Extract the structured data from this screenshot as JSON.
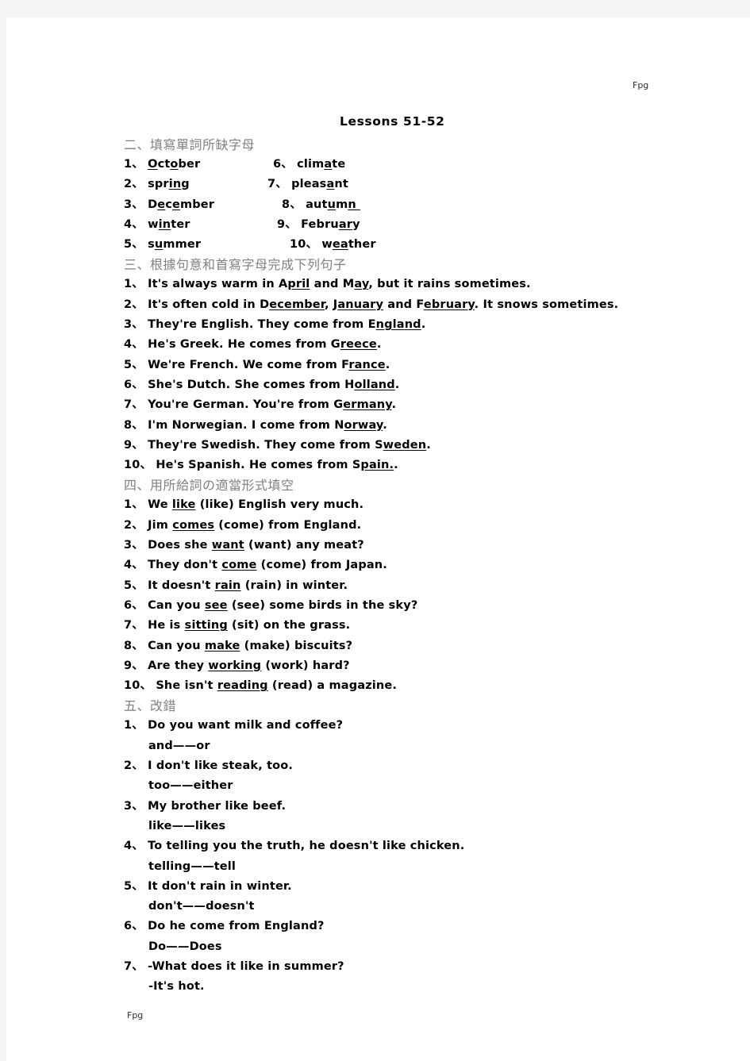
{
  "document": {
    "title": "Lessons 51-52",
    "watermark": "Fpg"
  },
  "section2": {
    "heading": "二、填寫單詞所缺字母",
    "rows": [
      {
        "left": {
          "num": "1、",
          "pre": "O",
          "mid": "ct",
          "fill1": "o",
          "post": "ber",
          "display": "October"
        },
        "right": {
          "num": "6、",
          "display": "climate"
        }
      },
      {
        "left": {
          "num": "2、",
          "display": "spring"
        },
        "right": {
          "num": "7、",
          "display": "pleasant"
        }
      },
      {
        "left": {
          "num": "3、",
          "display": "December"
        },
        "right": {
          "num": "8、",
          "display": "autumn"
        }
      },
      {
        "left": {
          "num": "4、",
          "display": "winter"
        },
        "right": {
          "num": "9、",
          "display": "February"
        }
      },
      {
        "left": {
          "num": "5、",
          "display": "summer"
        },
        "right": {
          "num": "10、",
          "display": "weather"
        }
      }
    ]
  },
  "section3": {
    "heading": "三、根據句意和首寫字母完成下列句子",
    "items": [
      {
        "num": "1、",
        "a": "It's always warm in A",
        "u1": "pril",
        "b": " and M",
        "u2": "ay",
        "c": ", but it rains sometimes."
      },
      {
        "num": "2、",
        "a": "It's often cold in D",
        "u1": "ecember",
        "b": ", J",
        "u2": "anuary",
        "c": " and F",
        "u3": "ebruary",
        "d": ". It snows sometimes."
      },
      {
        "num": "3、",
        "a": "They're English. They come from E",
        "u1": "ngland",
        "c": "."
      },
      {
        "num": "4、",
        "a": "He's Greek. He comes from G",
        "u1": "reece",
        "c": "."
      },
      {
        "num": "5、",
        "a": "We're French. We come from F",
        "u1": "rance",
        "c": "."
      },
      {
        "num": "6、",
        "a": "She's Dutch. She comes from H",
        "u1": "olland",
        "c": "."
      },
      {
        "num": "7、",
        "a": "You're German. You're from G",
        "u1": "ermany",
        "c": "."
      },
      {
        "num": "8、",
        "a": "I'm Norwegian. I come from N",
        "u1": "orway",
        "c": "."
      },
      {
        "num": "9、",
        "a": "They're Swedish. They come from S",
        "u1": "weden",
        "c": "."
      },
      {
        "num": "10、",
        "a": "He's Spanish. He comes from S",
        "u1": "pain.",
        "c": "."
      }
    ]
  },
  "section4": {
    "heading": "四、用所給詞の適當形式填空",
    "items": [
      {
        "num": "1、",
        "a": "We ",
        "u1": "like",
        "c": " (like) English very much."
      },
      {
        "num": "2、",
        "a": "Jim ",
        "u1": "comes",
        "c": " (come) from England."
      },
      {
        "num": "3、",
        "a": "Does she ",
        "u1": "want",
        "c": " (want) any meat?"
      },
      {
        "num": "4、",
        "a": "They don't ",
        "u1": "come",
        "c": " (come) from Japan."
      },
      {
        "num": "5、",
        "a": "It doesn't ",
        "u1": "rain",
        "c": " (rain) in winter."
      },
      {
        "num": "6、",
        "a": "Can you ",
        "u1": "see",
        "c": " (see) some birds in the sky?"
      },
      {
        "num": "7、",
        "a": "He is ",
        "u1": "sitting",
        "c": " (sit) on the grass."
      },
      {
        "num": "8、",
        "a": "Can you ",
        "u1": "make",
        "c": " (make) biscuits?"
      },
      {
        "num": "9、",
        "a": "Are they ",
        "u1": "working",
        "c": " (work) hard?"
      },
      {
        "num": "10、",
        "a": "She isn't ",
        "u1": "reading",
        "c": " (read) a magazine."
      }
    ]
  },
  "section5": {
    "heading": "五、改錯",
    "items": [
      {
        "num": "1、",
        "sentence": "Do you want milk and coffee?",
        "answer": "and——or"
      },
      {
        "num": "2、",
        "sentence": "I don't like steak, too.",
        "answer": "too——either"
      },
      {
        "num": "3、",
        "sentence": "My brother like beef.",
        "answer": "like——likes"
      },
      {
        "num": "4、",
        "sentence": "To telling you the truth, he doesn't like chicken.",
        "answer": "telling——tell"
      },
      {
        "num": "5、",
        "sentence": "It don't rain in winter.",
        "answer": "don't——doesn't"
      },
      {
        "num": "6、",
        "sentence": "Do he come from England?",
        "answer": "Do——Does"
      },
      {
        "num": "7、",
        "sentence": "-What does it like in summer?",
        "answer": "-It's hot."
      }
    ]
  }
}
